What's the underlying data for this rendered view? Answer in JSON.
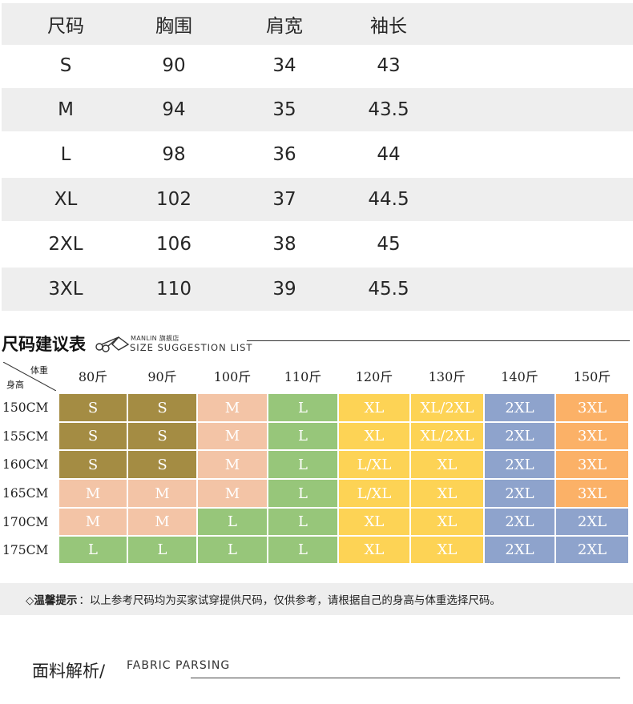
{
  "measurements": {
    "headers": [
      "尺码",
      "胸围",
      "肩宽",
      "袖长"
    ],
    "rows": [
      [
        "S",
        "90",
        "34",
        "43"
      ],
      [
        "M",
        "94",
        "35",
        "43.5"
      ],
      [
        "L",
        "98",
        "36",
        "44"
      ],
      [
        "XL",
        "102",
        "37",
        "44.5"
      ],
      [
        "2XL",
        "106",
        "38",
        "45"
      ],
      [
        "3XL",
        "110",
        "39",
        "45.5"
      ]
    ]
  },
  "suggestion": {
    "title": "尺码建议表",
    "brand": "MANLIN 旗舰店",
    "subtitle": "SIZE SUGGESTION LIST",
    "corner_weight": "体重",
    "corner_height": "身高",
    "weights": [
      "80斤",
      "90斤",
      "100斤",
      "110斤",
      "120斤",
      "130斤",
      "140斤",
      "150斤"
    ],
    "heights": [
      "150CM",
      "155CM",
      "160CM",
      "165CM",
      "170CM",
      "175CM"
    ],
    "grid": [
      [
        "S",
        "S",
        "M",
        "L",
        "XL",
        "XL/2XL",
        "2XL",
        "3XL"
      ],
      [
        "S",
        "S",
        "M",
        "L",
        "XL",
        "XL/2XL",
        "2XL",
        "3XL"
      ],
      [
        "S",
        "S",
        "M",
        "L",
        "L/XL",
        "XL",
        "2XL",
        "3XL"
      ],
      [
        "M",
        "M",
        "M",
        "L",
        "L/XL",
        "XL",
        "2XL",
        "3XL"
      ],
      [
        "M",
        "M",
        "L",
        "L",
        "XL",
        "XL",
        "2XL",
        "2XL"
      ],
      [
        "L",
        "L",
        "L",
        "L",
        "XL",
        "XL",
        "2XL",
        "2XL"
      ]
    ],
    "colors": {
      "S": "#a48c43",
      "M": "#f3c4a6",
      "L": "#97c67a",
      "L/XL": "#fdd355",
      "XL": "#fdd355",
      "XL/2XL": "#fdd355",
      "2XL": "#8ea3cc",
      "3XL": "#fbb167"
    }
  },
  "tip": {
    "label": "◇温馨提示",
    "text": "：以上参考尺码均为买家试穿提供尺码，仅供参考，请根据自己的身高与体重选择尺码。"
  },
  "fabric": {
    "title_zh": "面料解析/",
    "title_en": "FABRIC PARSING"
  }
}
